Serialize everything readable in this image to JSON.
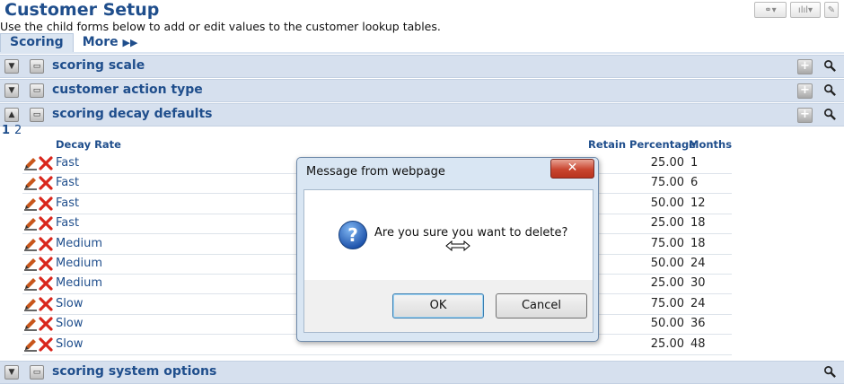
{
  "header": {
    "title": "Customer Setup",
    "subtitle": "Use the child forms below to add or edit values to the customer lookup tables."
  },
  "tabs": [
    {
      "label": "Scoring",
      "active": true
    },
    {
      "label": "More",
      "active": false
    }
  ],
  "sections": {
    "scoring_scale": "scoring scale",
    "customer_action_type": "customer action type",
    "scoring_decay_defaults": "scoring decay defaults",
    "scoring_system_options": "scoring system options"
  },
  "pager": {
    "current": "1",
    "next": "2"
  },
  "table": {
    "columns": {
      "rate": "Decay Rate",
      "pct": "Retain Percentage",
      "months": "Months"
    },
    "rows": [
      {
        "rate": "Fast",
        "pct": "25.00",
        "months": "1"
      },
      {
        "rate": "Fast",
        "pct": "75.00",
        "months": "6"
      },
      {
        "rate": "Fast",
        "pct": "50.00",
        "months": "12"
      },
      {
        "rate": "Fast",
        "pct": "25.00",
        "months": "18"
      },
      {
        "rate": "Medium",
        "pct": "75.00",
        "months": "18"
      },
      {
        "rate": "Medium",
        "pct": "50.00",
        "months": "24"
      },
      {
        "rate": "Medium",
        "pct": "25.00",
        "months": "30"
      },
      {
        "rate": "Slow",
        "pct": "75.00",
        "months": "24"
      },
      {
        "rate": "Slow",
        "pct": "50.00",
        "months": "36"
      },
      {
        "rate": "Slow",
        "pct": "25.00",
        "months": "48"
      }
    ]
  },
  "dialog": {
    "title": "Message from webpage",
    "message": "Are you sure you want to delete?",
    "ok": "OK",
    "cancel": "Cancel",
    "close": "✕"
  },
  "icons": {
    "edit": "pencil-icon",
    "delete": "delete-x-icon",
    "question": "question-icon",
    "search": "magnifier-icon",
    "add": "plus-icon"
  },
  "colors": {
    "accent": "#1f4e8c",
    "section_bg": "#d6e0ee",
    "delete_red": "#d9261c",
    "edit_orange": "#c8561b"
  }
}
